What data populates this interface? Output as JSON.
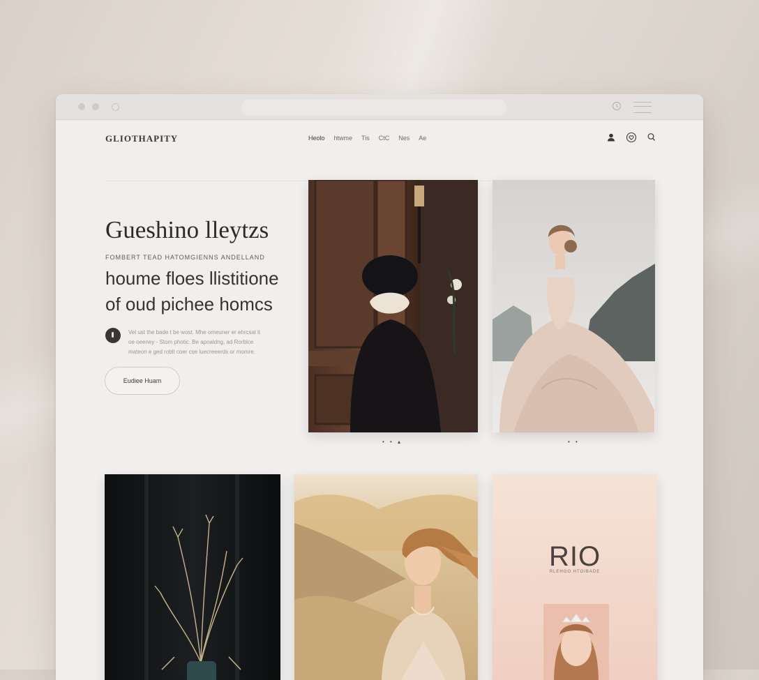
{
  "nav": {
    "logo": "GLIOTHAPITY",
    "links": [
      "Heolo",
      "htwme",
      "Tis",
      "CtC",
      "Nes",
      "Ae"
    ]
  },
  "hero": {
    "title": "Gueshino lleytzs",
    "eyebrow": "FOMBERT TEAD HATOMGIENNS ANDELLAND",
    "subtitle_line1": "houme floes llistitione",
    "subtitle_line2": "of oud pichee homcs",
    "body_line1": "Vel ust the bade t be wost. Mhe omeuner er ehrcsal it",
    "body_line2": "oe oeeney - Stom photic. Be apoaldng, ad Rorblce",
    "body_line3": "mateon e ged roblt coer cse luecreeerds or momre.",
    "cta_label": "Eudiee Huam"
  },
  "gallery": {
    "pager1": "• • ▴",
    "pager2": "• •",
    "card5_title": "RIO",
    "card5_subtitle": "RLEHGO HTOIBADE"
  },
  "colors": {
    "background": "#e0d9d2",
    "window": "#f1efed",
    "text_dark": "#2d2a28",
    "accent_blush": "#f2d6c8"
  },
  "icons": [
    "user-icon",
    "heart-icon",
    "search-icon",
    "clock-icon",
    "menu-icon"
  ]
}
